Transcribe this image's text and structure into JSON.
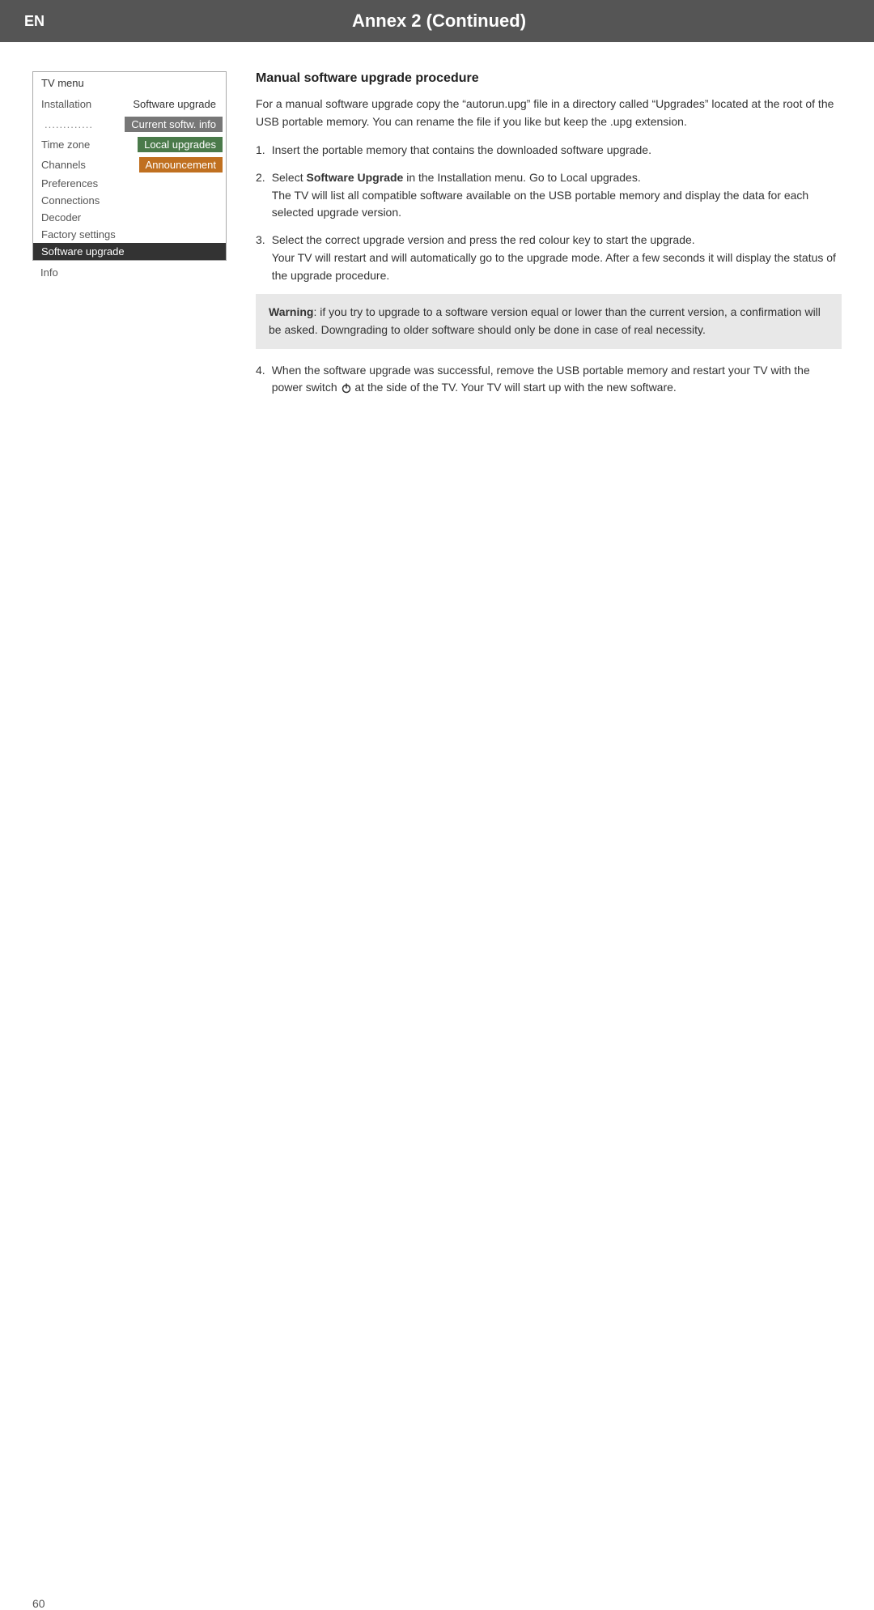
{
  "header": {
    "lang": "EN",
    "title": "Annex 2   (Continued)"
  },
  "tv_menu": {
    "title": "TV menu",
    "rows": [
      {
        "label": "Installation",
        "value": "Software upgrade",
        "style": "normal"
      },
      {
        "label": ".............",
        "value": "Current softw. info",
        "style": "highlighted"
      },
      {
        "label": "Time zone",
        "value": "Local upgrades",
        "style": "green"
      },
      {
        "label": "Channels",
        "value": "Announcement",
        "style": "orange"
      },
      {
        "label": "Preferences",
        "value": "",
        "style": "normal"
      },
      {
        "label": "Connections",
        "value": "",
        "style": "normal"
      },
      {
        "label": "Decoder",
        "value": "",
        "style": "normal"
      },
      {
        "label": "Factory settings",
        "value": "",
        "style": "normal"
      },
      {
        "label": "Software upgrade",
        "value": "",
        "style": "selected"
      }
    ],
    "info_item": "Info"
  },
  "main": {
    "section_heading": "Manual software upgrade procedure",
    "intro_text": "For a manual software upgrade copy the “autorun.upg” file in a directory called “Upgrades” located at the root of the USB portable memory. You can rename the file if you like but keep the .upg extension.",
    "steps": [
      {
        "number": "1.",
        "text": "Insert the portable memory that contains the downloaded software upgrade."
      },
      {
        "number": "2.",
        "text_before": "Select ",
        "bold": "Software Upgrade",
        "text_after": " in the Installation menu. Go to Local upgrades.\nThe TV will list all compatible software available on the USB portable memory and display the data for each selected upgrade version."
      },
      {
        "number": "3.",
        "text": "Select the correct upgrade version and press the red colour key to start the upgrade.\nYour TV will restart and will automatically go to the upgrade mode. After a few seconds it will display the status of the upgrade procedure."
      }
    ],
    "warning": {
      "bold_label": "Warning",
      "text": ": if you try to upgrade to a software version equal or lower than the current version, a confirmation will be asked. Downgrading to older software should only be done in case of real necessity."
    },
    "step4": {
      "number": "4.",
      "text_before": "When the software upgrade was successful, remove the USB portable memory and restart your TV with the power switch ",
      "text_after": " at the side of the TV. Your TV will start up with the new software."
    }
  },
  "footer": {
    "page_number": "60"
  }
}
